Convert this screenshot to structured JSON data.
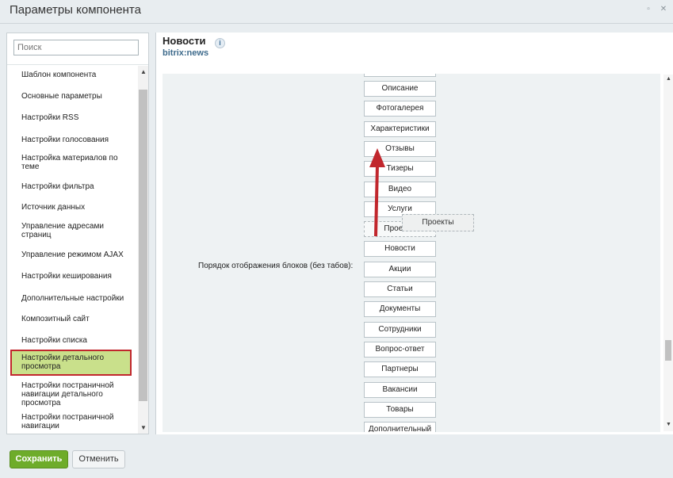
{
  "window": {
    "title": "Параметры компонента"
  },
  "sidebar": {
    "search_placeholder": "Поиск",
    "items": [
      {
        "label": "Шаблон компонента"
      },
      {
        "label": "Основные параметры"
      },
      {
        "label": "Настройки RSS"
      },
      {
        "label": "Настройки голосования"
      },
      {
        "label": "Настройка материалов по теме"
      },
      {
        "label": "Настройки фильтра"
      },
      {
        "label": "Источник данных"
      },
      {
        "label": "Управление адресами страниц"
      },
      {
        "label": "Управление режимом AJAX"
      },
      {
        "label": "Настройки кеширования"
      },
      {
        "label": "Дополнительные настройки"
      },
      {
        "label": "Композитный сайт"
      },
      {
        "label": "Настройки списка"
      },
      {
        "label": "Настройки детального просмотра",
        "active": true
      },
      {
        "label": "Настройки постраничной навигации детального просмотра"
      },
      {
        "label": "Настройки постраничной навигации"
      }
    ]
  },
  "component": {
    "name": "Новости",
    "code": "bitrix:news",
    "info_icon": "info-icon"
  },
  "field": {
    "label": "Порядок отображения блоков (без табов):",
    "items": [
      "Описание",
      "Фотогалерея",
      "Характеристики",
      "Отзывы",
      "Тизеры",
      "Видео",
      "Услуги",
      "Проекты",
      "Новости",
      "Акции",
      "Статьи",
      "Документы",
      "Сотрудники",
      "Вопрос-ответ",
      "Партнеры",
      "Вакансии",
      "Товары",
      "Дополнительный"
    ],
    "dragging": "Проекты"
  },
  "footer": {
    "save_label": "Сохранить",
    "cancel_label": "Отменить"
  },
  "colors": {
    "accent_green": "#6eac2a",
    "highlight": "#c9e08b",
    "annotation_red": "#c1272d"
  }
}
